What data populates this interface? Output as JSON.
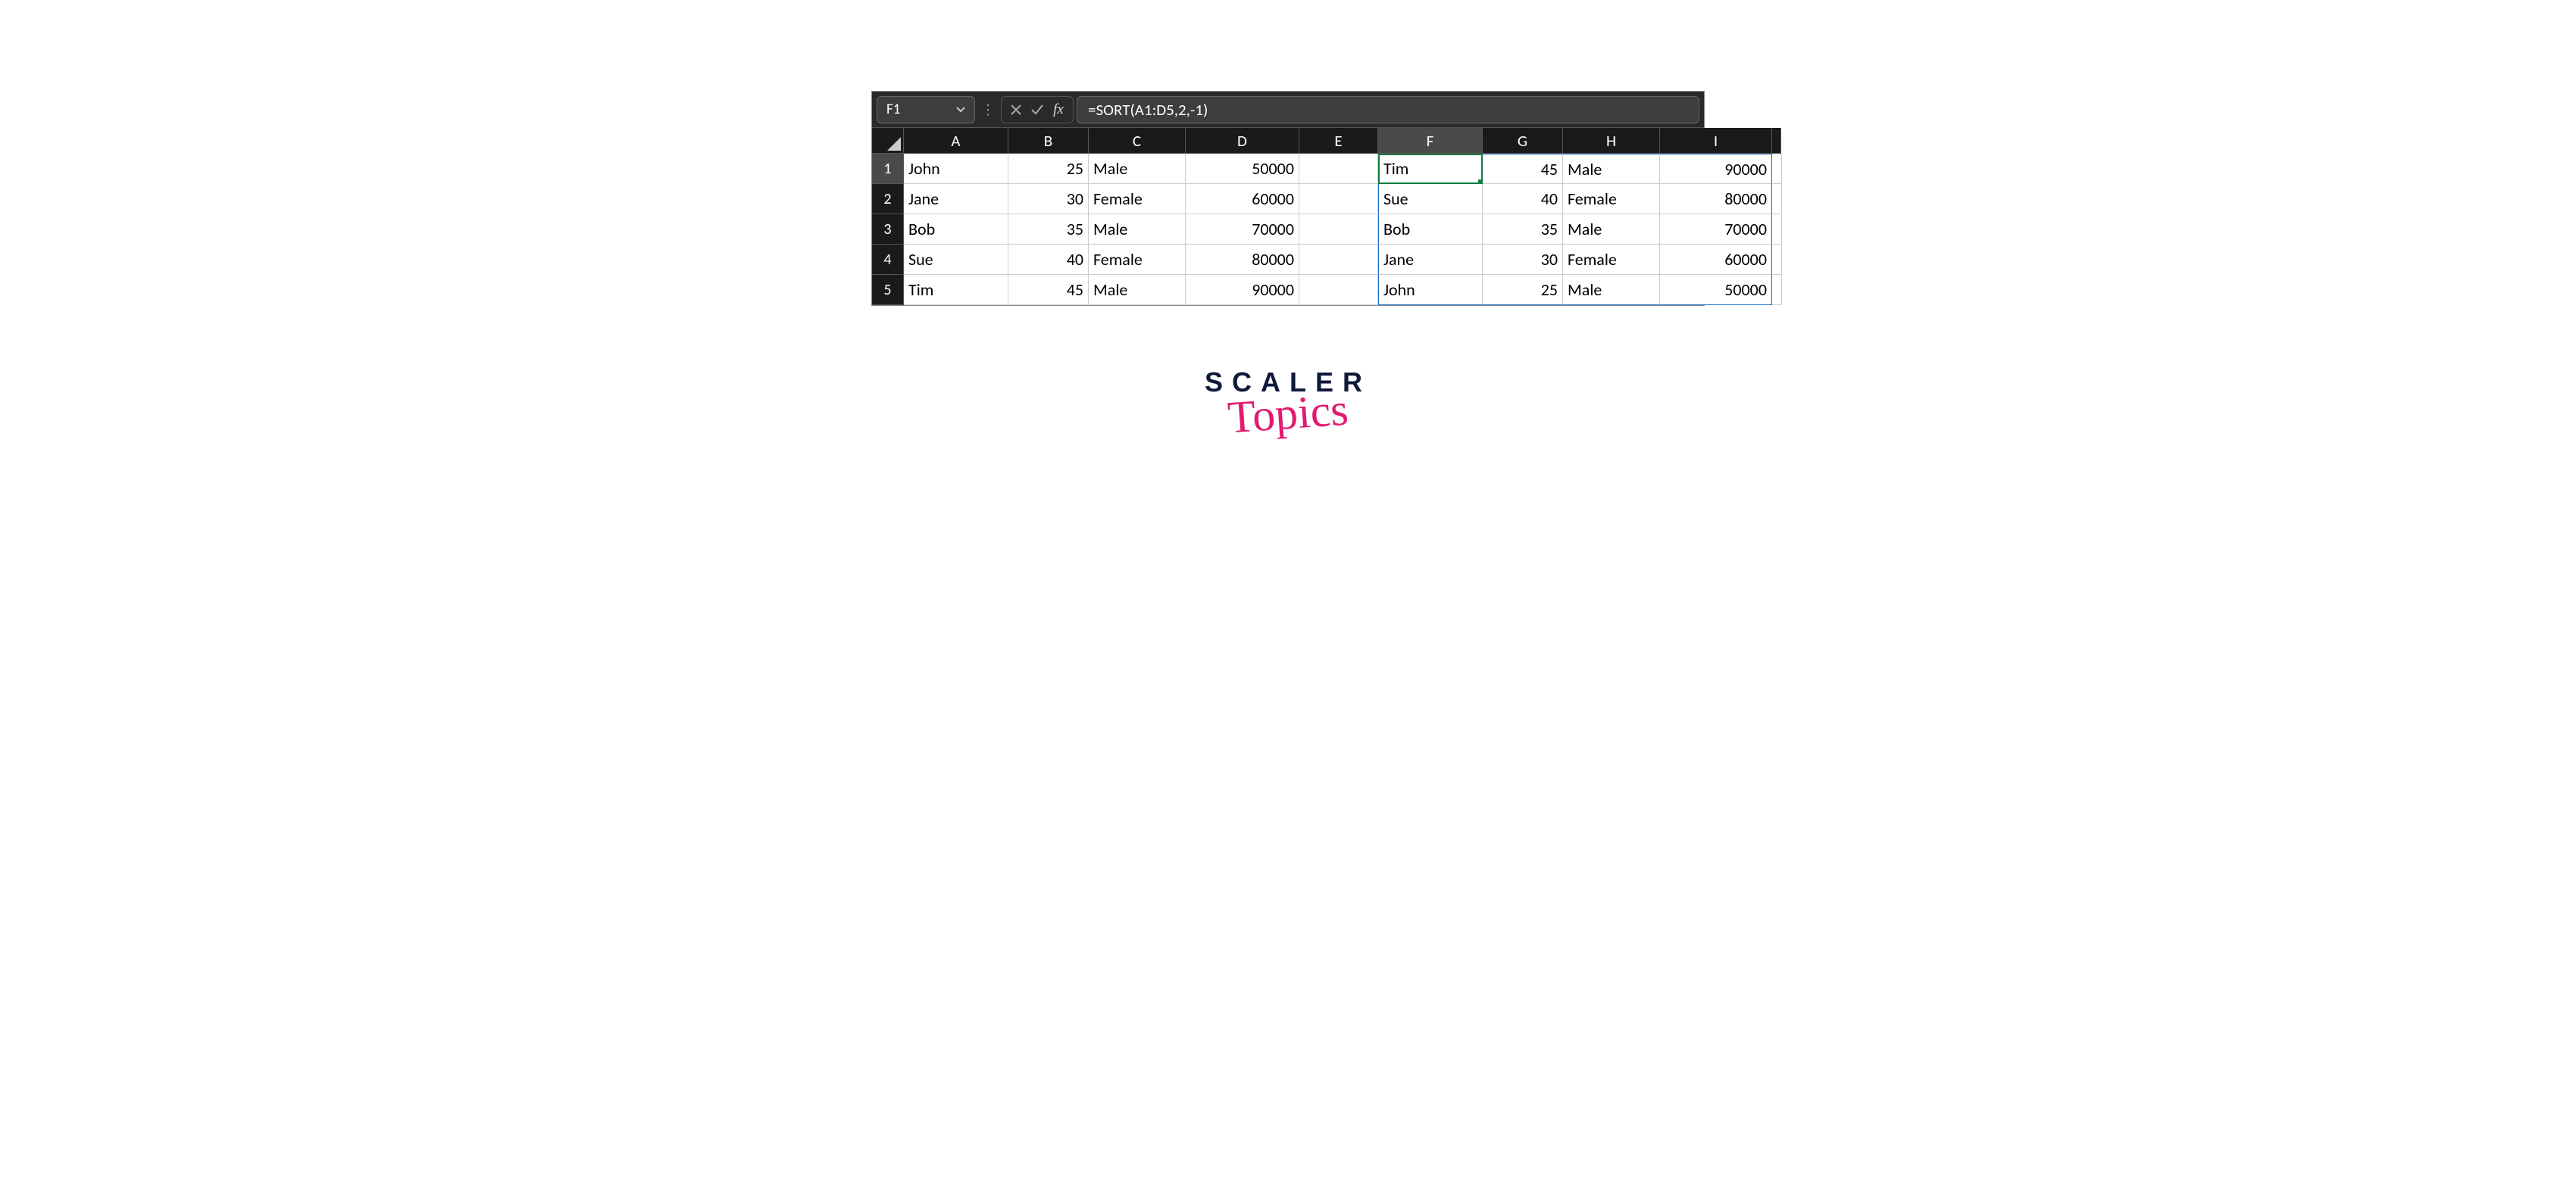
{
  "name_box": "F1",
  "formula": "=SORT(A1:D5,2,-1)",
  "columns": [
    "A",
    "B",
    "C",
    "D",
    "E",
    "F",
    "G",
    "H",
    "I"
  ],
  "selected_column": "F",
  "selected_row": 1,
  "rows": [
    {
      "n": "1",
      "A": "John",
      "B": "25",
      "C": "Male",
      "D": "50000",
      "E": "",
      "F": "Tim",
      "G": "45",
      "H": "Male",
      "I": "90000"
    },
    {
      "n": "2",
      "A": "Jane",
      "B": "30",
      "C": "Female",
      "D": "60000",
      "E": "",
      "F": "Sue",
      "G": "40",
      "H": "Female",
      "I": "80000"
    },
    {
      "n": "3",
      "A": "Bob",
      "B": "35",
      "C": "Male",
      "D": "70000",
      "E": "",
      "F": "Bob",
      "G": "35",
      "H": "Male",
      "I": "70000"
    },
    {
      "n": "4",
      "A": "Sue",
      "B": "40",
      "C": "Female",
      "D": "80000",
      "E": "",
      "F": "Jane",
      "G": "30",
      "H": "Female",
      "I": "60000"
    },
    {
      "n": "5",
      "A": "Tim",
      "B": "45",
      "C": "Male",
      "D": "90000",
      "E": "",
      "F": "John",
      "G": "25",
      "H": "Male",
      "I": "50000"
    }
  ],
  "branding": {
    "line1": "SCALER",
    "line2": "Topics"
  }
}
